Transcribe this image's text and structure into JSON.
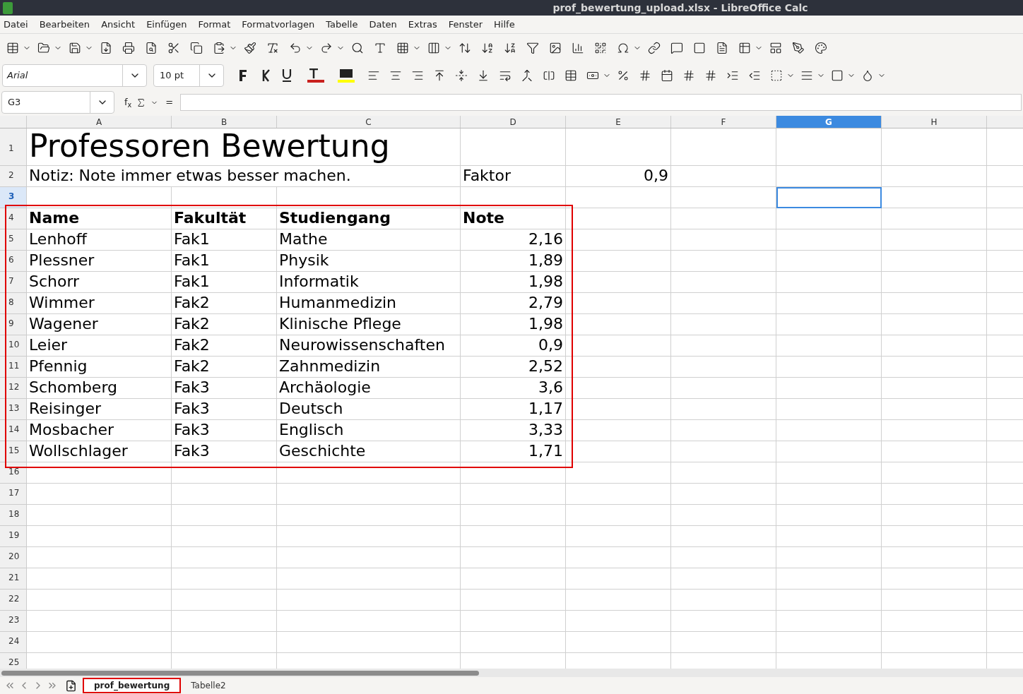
{
  "window": {
    "title": "prof_bewertung_upload.xlsx - LibreOffice Calc"
  },
  "menu": [
    "Datei",
    "Bearbeiten",
    "Ansicht",
    "Einfügen",
    "Format",
    "Formatvorlagen",
    "Tabelle",
    "Daten",
    "Extras",
    "Fenster",
    "Hilfe"
  ],
  "formatting_bar": {
    "font_name": "Arial",
    "font_size": "10 pt"
  },
  "formula_bar": {
    "name_box": "G3",
    "function_wizard": "f$_{x}$",
    "function_symbol": "="
  },
  "columns": [
    {
      "label": "A",
      "selected": false
    },
    {
      "label": "B",
      "selected": false
    },
    {
      "label": "C",
      "selected": false
    },
    {
      "label": "D",
      "selected": false
    },
    {
      "label": "E",
      "selected": false
    },
    {
      "label": "F",
      "selected": false
    },
    {
      "label": "G",
      "selected": true
    },
    {
      "label": "H",
      "selected": false
    }
  ],
  "rows": [
    {
      "number": "1",
      "selected": false,
      "cells": [
        {
          "text": "Professoren Bewertung",
          "kind": "title"
        },
        null,
        null
      ]
    },
    {
      "number": "2",
      "selected": false,
      "cells": [
        {
          "text": "Notiz: Note immer etwas besser machen.",
          "kind": "text"
        },
        null,
        null,
        {
          "text": "Faktor",
          "kind": "text"
        },
        {
          "text": "0,9",
          "kind": "number"
        }
      ]
    },
    {
      "number": "3",
      "selected": true,
      "cells": []
    },
    {
      "number": "4",
      "selected": false,
      "cells": [
        {
          "text": "Name",
          "kind": "heading"
        },
        {
          "text": "Fakultät",
          "kind": "heading"
        },
        {
          "text": "Studiengang",
          "kind": "heading"
        },
        {
          "text": "Note",
          "kind": "heading"
        }
      ]
    },
    {
      "number": "5",
      "selected": false,
      "cells": [
        {
          "text": "Lenhoff",
          "kind": "text"
        },
        {
          "text": "Fak1",
          "kind": "text"
        },
        {
          "text": "Mathe",
          "kind": "text"
        },
        {
          "text": "2,16",
          "kind": "number"
        }
      ]
    },
    {
      "number": "6",
      "selected": false,
      "cells": [
        {
          "text": "Plessner",
          "kind": "text"
        },
        {
          "text": "Fak1",
          "kind": "text"
        },
        {
          "text": "Physik",
          "kind": "text"
        },
        {
          "text": "1,89",
          "kind": "number"
        }
      ]
    },
    {
      "number": "7",
      "selected": false,
      "cells": [
        {
          "text": "Schorr",
          "kind": "text"
        },
        {
          "text": "Fak1",
          "kind": "text"
        },
        {
          "text": "Informatik",
          "kind": "text"
        },
        {
          "text": "1,98",
          "kind": "number"
        }
      ]
    },
    {
      "number": "8",
      "selected": false,
      "cells": [
        {
          "text": "Wimmer",
          "kind": "text"
        },
        {
          "text": "Fak2",
          "kind": "text"
        },
        {
          "text": "Humanmedizin",
          "kind": "text"
        },
        {
          "text": "2,79",
          "kind": "number"
        }
      ]
    },
    {
      "number": "9",
      "selected": false,
      "cells": [
        {
          "text": "Wagener",
          "kind": "text"
        },
        {
          "text": "Fak2",
          "kind": "text"
        },
        {
          "text": "Klinische Pflege",
          "kind": "text"
        },
        {
          "text": "1,98",
          "kind": "number"
        }
      ]
    },
    {
      "number": "10",
      "selected": false,
      "cells": [
        {
          "text": "Leier",
          "kind": "text"
        },
        {
          "text": "Fak2",
          "kind": "text"
        },
        {
          "text": "Neurowissenschaften",
          "kind": "text"
        },
        {
          "text": "0,9",
          "kind": "number"
        }
      ]
    },
    {
      "number": "11",
      "selected": false,
      "cells": [
        {
          "text": "Pfennig",
          "kind": "text"
        },
        {
          "text": "Fak2",
          "kind": "text"
        },
        {
          "text": "Zahnmedizin",
          "kind": "text"
        },
        {
          "text": "2,52",
          "kind": "number"
        }
      ]
    },
    {
      "number": "12",
      "selected": false,
      "cells": [
        {
          "text": "Schomberg",
          "kind": "text"
        },
        {
          "text": "Fak3",
          "kind": "text"
        },
        {
          "text": "Archäologie",
          "kind": "text"
        },
        {
          "text": "3,6",
          "kind": "number"
        }
      ]
    },
    {
      "number": "13",
      "selected": false,
      "cells": [
        {
          "text": "Reisinger",
          "kind": "text"
        },
        {
          "text": "Fak3",
          "kind": "text"
        },
        {
          "text": "Deutsch",
          "kind": "text"
        },
        {
          "text": "1,17",
          "kind": "number"
        }
      ]
    },
    {
      "number": "14",
      "selected": false,
      "cells": [
        {
          "text": "Mosbacher",
          "kind": "text"
        },
        {
          "text": "Fak3",
          "kind": "text"
        },
        {
          "text": "Englisch",
          "kind": "text"
        },
        {
          "text": "3,33",
          "kind": "number"
        }
      ]
    },
    {
      "number": "15",
      "selected": false,
      "cells": [
        {
          "text": "Wollschlager",
          "kind": "text"
        },
        {
          "text": "Fak3",
          "kind": "text"
        },
        {
          "text": "Geschichte",
          "kind": "text"
        },
        {
          "text": "1,71",
          "kind": "number"
        }
      ]
    },
    {
      "number": "16",
      "selected": false,
      "cells": []
    },
    {
      "number": "17",
      "selected": false,
      "cells": []
    },
    {
      "number": "18",
      "selected": false,
      "cells": []
    },
    {
      "number": "19",
      "selected": false,
      "cells": []
    },
    {
      "number": "20",
      "selected": false,
      "cells": []
    },
    {
      "number": "21",
      "selected": false,
      "cells": []
    },
    {
      "number": "22",
      "selected": false,
      "cells": []
    },
    {
      "number": "23",
      "selected": false,
      "cells": []
    },
    {
      "number": "24",
      "selected": false,
      "cells": []
    },
    {
      "number": "25",
      "selected": false,
      "cells": []
    }
  ],
  "sheet_tabs": [
    {
      "label": "prof_bewertung",
      "selected": true
    },
    {
      "label": "Tabelle2",
      "selected": false
    }
  ]
}
